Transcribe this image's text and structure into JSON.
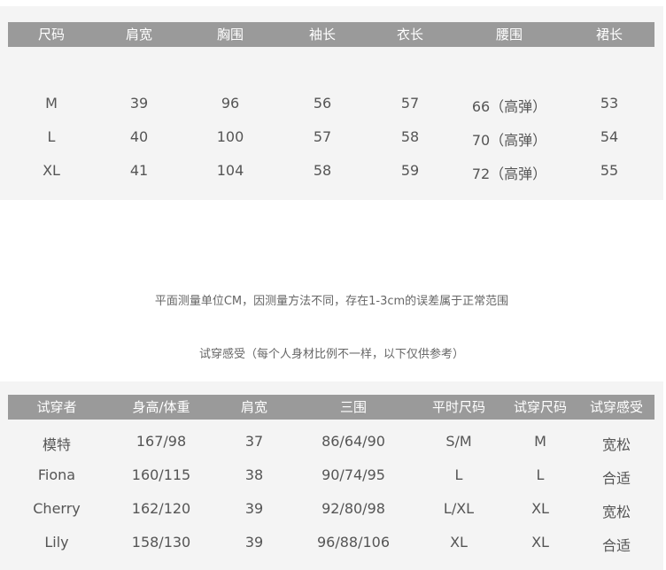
{
  "size_table": {
    "headers": [
      "尺码",
      "肩宽",
      "胸围",
      "袖长",
      "衣长",
      "腰围",
      "裙长"
    ],
    "rows": [
      [
        "M",
        "39",
        "96",
        "56",
        "57",
        "66（高弹）",
        "53"
      ],
      [
        "L",
        "40",
        "100",
        "57",
        "58",
        "70（高弹）",
        "54"
      ],
      [
        "XL",
        "41",
        "104",
        "58",
        "59",
        "72（高弹）",
        "55"
      ]
    ]
  },
  "notes": {
    "measurement": "平面测量单位CM，因测量方法不同，存在1-3cm的误差属于正常范围",
    "fitting_title": "试穿感受（每个人身材比例不一样，以下仅供参考）"
  },
  "fit_table": {
    "headers": [
      "试穿者",
      "身高/体重",
      "肩宽",
      "三围",
      "平时尺码",
      "试穿尺码",
      "试穿感受"
    ],
    "rows": [
      [
        "模特",
        "167/98",
        "37",
        "86/64/90",
        "S/M",
        "M",
        "宽松"
      ],
      [
        "Fiona",
        "160/115",
        "38",
        "90/74/95",
        "L",
        "L",
        "合适"
      ],
      [
        "Cherry",
        "162/120",
        "39",
        "92/80/98",
        "L/XL",
        "XL",
        "宽松"
      ],
      [
        "Lily",
        "158/130",
        "39",
        "96/88/106",
        "XL",
        "XL",
        "合适"
      ]
    ]
  },
  "colors": {
    "header_bg": "#9a9a9a",
    "header_text": "#ffffff",
    "panel_bg": "#f4f4f4",
    "body_text": "#555555"
  }
}
